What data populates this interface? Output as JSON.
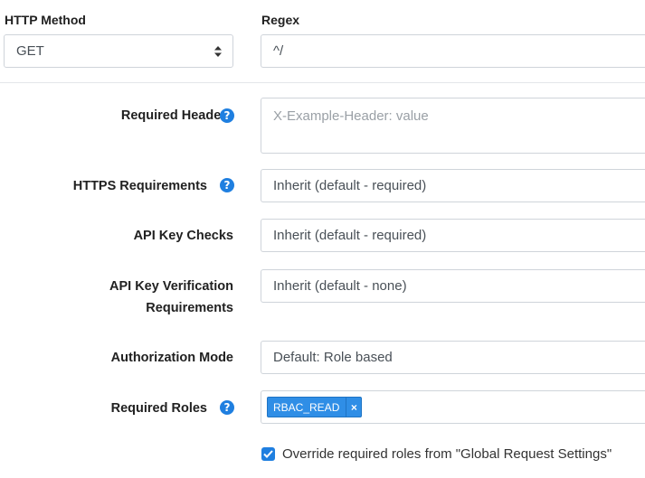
{
  "top": {
    "method_label": "HTTP Method",
    "method_value": "GET",
    "regex_label": "Regex",
    "regex_value": "^/"
  },
  "form": {
    "required_headers": {
      "label": "Required Headers",
      "placeholder": "X-Example-Header: value",
      "help_icon": "question-circle-icon"
    },
    "https_requirements": {
      "label": "HTTPS Requirements",
      "value": "Inherit (default - required)",
      "help_icon": "question-circle-icon"
    },
    "api_key_checks": {
      "label": "API Key Checks",
      "value": "Inherit (default - required)"
    },
    "api_key_verification": {
      "label_line1": "API Key Verification",
      "label_line2": "Requirements",
      "value": "Inherit (default - none)"
    },
    "authorization_mode": {
      "label": "Authorization Mode",
      "value": "Default: Role based"
    },
    "required_roles": {
      "label": "Required Roles",
      "help_icon": "question-circle-icon",
      "tags": [
        "RBAC_READ"
      ],
      "remove_glyph": "×"
    },
    "override": {
      "checked": true,
      "label": "Override required roles from \"Global Request Settings\""
    }
  },
  "colors": {
    "accent": "#1f7fe0",
    "tag_bg": "#2f8ee6",
    "border": "#cfd4da",
    "label_text": "#212121"
  }
}
